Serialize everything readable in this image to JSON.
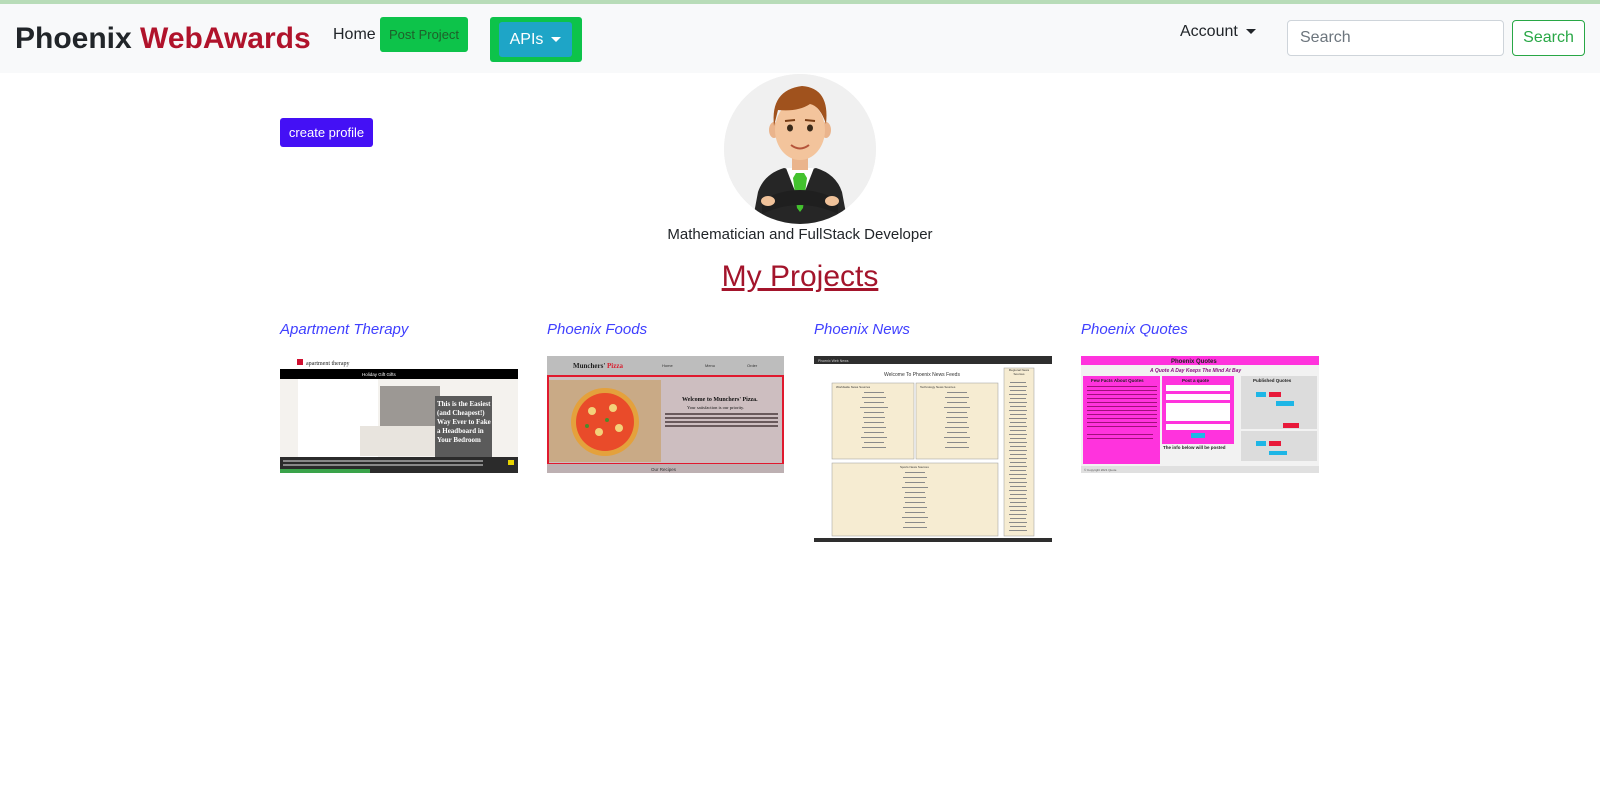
{
  "navbar": {
    "brand_part1": "Phoenix",
    "brand_part2": "WebAwards",
    "home_label": "Home",
    "post_project_label": "Post Project",
    "apis_label": "APIs",
    "account_label": "Account",
    "search_placeholder": "Search",
    "search_button_label": "Search"
  },
  "profile": {
    "create_profile_label": "create profile",
    "tagline": "Mathematician and FullStack Developer",
    "avatar_icon": "avatar-icon"
  },
  "projects": {
    "section_title": "My Projects",
    "items": [
      {
        "title": "Apartment Therapy",
        "thumb": {
          "logo": "apartment therapy",
          "bar_text": "Holiday Gift Gifts",
          "headline": "This is the Easiest (and Cheapest!) Way Ever to Fake a Headboard in Your Bedroom"
        }
      },
      {
        "title": "Phoenix Foods",
        "thumb": {
          "brand_a": "Munchers'",
          "brand_b": "Pizza",
          "nav": [
            "Home",
            "Menu",
            "Order"
          ],
          "headline": "Welcome to Munchers' Pizza.",
          "sub": "Your satisfaction is our priority.",
          "footer": "Our Recipes"
        }
      },
      {
        "title": "Phoenix News",
        "thumb": {
          "header": "Phoenix Web News",
          "headline": "Welcome To Phoenix News Feeds",
          "col1_title": "Worldwide News Sources",
          "col2_title": "Technology News Sources",
          "col3_title": "Sports News Sources",
          "side_title": "Regional News Sources"
        }
      },
      {
        "title": "Phoenix Quotes",
        "thumb": {
          "title": "Phoenix Quotes",
          "subtitle": "A Quote A Day Keeps The Mind At Bay",
          "col1_title": "Few Facts About Quotes",
          "col2_title": "Post a quote",
          "col3_title": "Published Quotes",
          "col2_footer": "The info below will be posted",
          "footer": "© Copyright 2021 Quote"
        }
      }
    ]
  },
  "colors": {
    "navbar_bg": "#f8f9fa",
    "brand_accent": "#b0132b",
    "green_button": "#0dc34a",
    "info_button": "#1ea5c7",
    "create_profile_bg": "#4410f5",
    "project_link": "#4040ff",
    "section_title": "#a3142b"
  }
}
